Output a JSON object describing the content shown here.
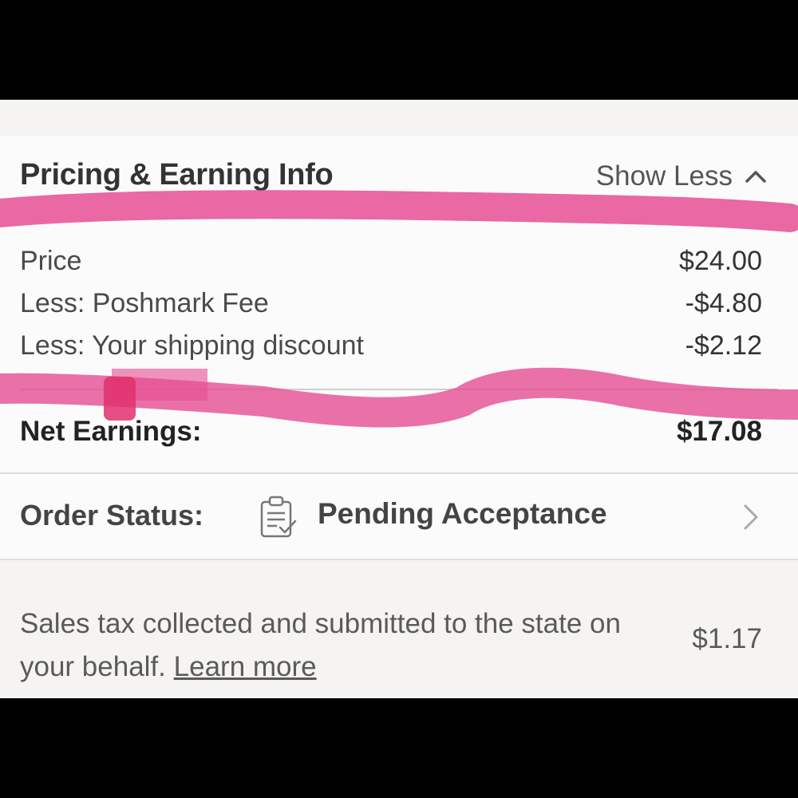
{
  "pricing": {
    "title": "Pricing & Earning Info",
    "toggle_label": "Show Less",
    "rows": [
      {
        "label": "Price",
        "value": "$24.00"
      },
      {
        "label": "Less: Poshmark Fee",
        "value": "-$4.80"
      },
      {
        "label": "Less: Your shipping discount",
        "value": "-$2.12"
      }
    ],
    "net_label": "Net Earnings:",
    "net_value": "$17.08"
  },
  "order_status": {
    "label": "Order Status:",
    "value": "Pending Acceptance",
    "icon": "clipboard-check-icon"
  },
  "tax": {
    "text": "Sales tax collected and submitted to the state on your behalf.",
    "link": "Learn more",
    "value": "$1.17"
  },
  "colors": {
    "highlight": "#e64d93",
    "text": "#333333"
  }
}
